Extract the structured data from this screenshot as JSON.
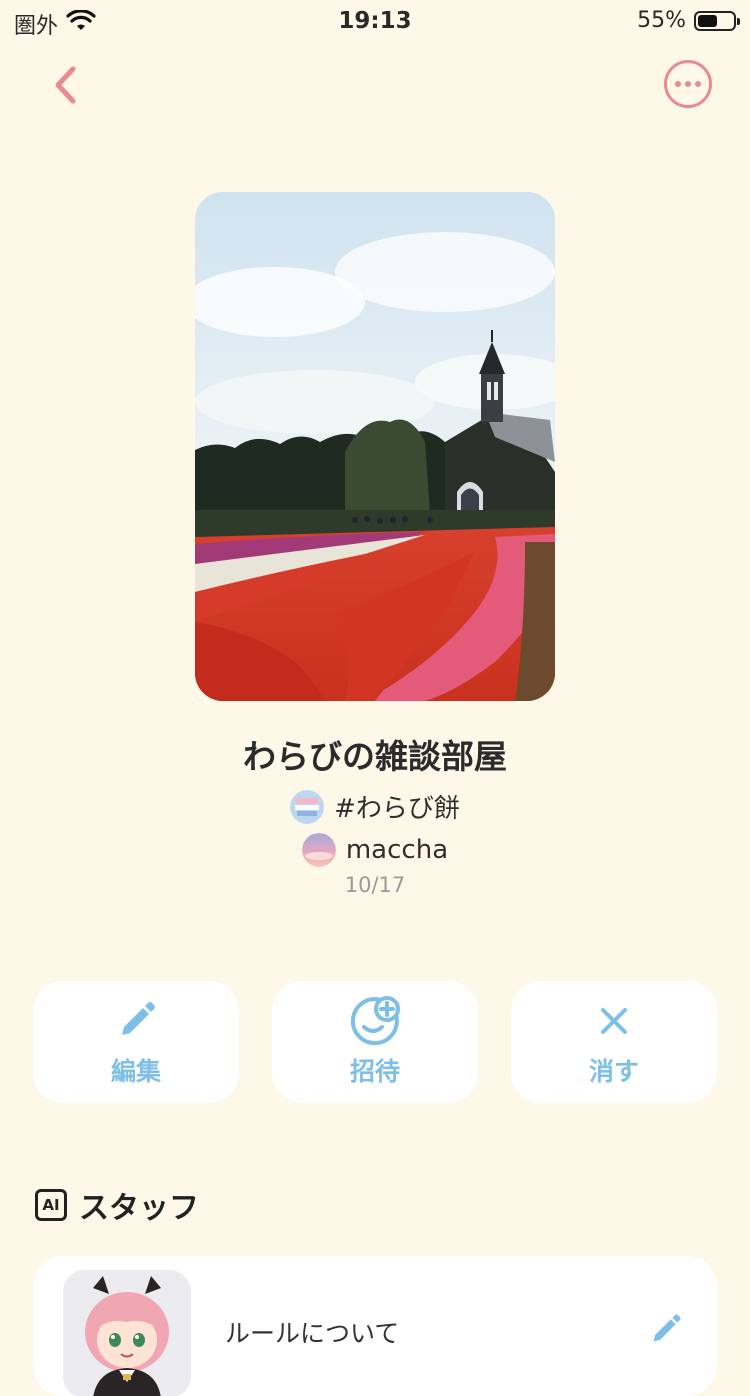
{
  "status_bar": {
    "carrier": "圏外",
    "time": "19:13",
    "battery_percent": "55%",
    "battery_level": 0.55
  },
  "room": {
    "title": "わらびの雑談部屋",
    "hashtag": "#わらび餅",
    "user": "maccha",
    "date": "10/17"
  },
  "actions": {
    "edit_label": "編集",
    "invite_label": "招待",
    "delete_label": "消す"
  },
  "staff_section": {
    "badge": "AI",
    "title": "スタッフ",
    "items": [
      {
        "text": "ルールについて"
      }
    ]
  },
  "colors": {
    "background": "#fdf8e8",
    "accent_pink": "#e88a92",
    "accent_blue": "#7ebfe8"
  },
  "icons": {
    "back": "chevron-left-icon",
    "more": "more-horizontal-icon",
    "edit": "pencil-icon",
    "invite": "add-face-icon",
    "delete": "close-icon"
  }
}
